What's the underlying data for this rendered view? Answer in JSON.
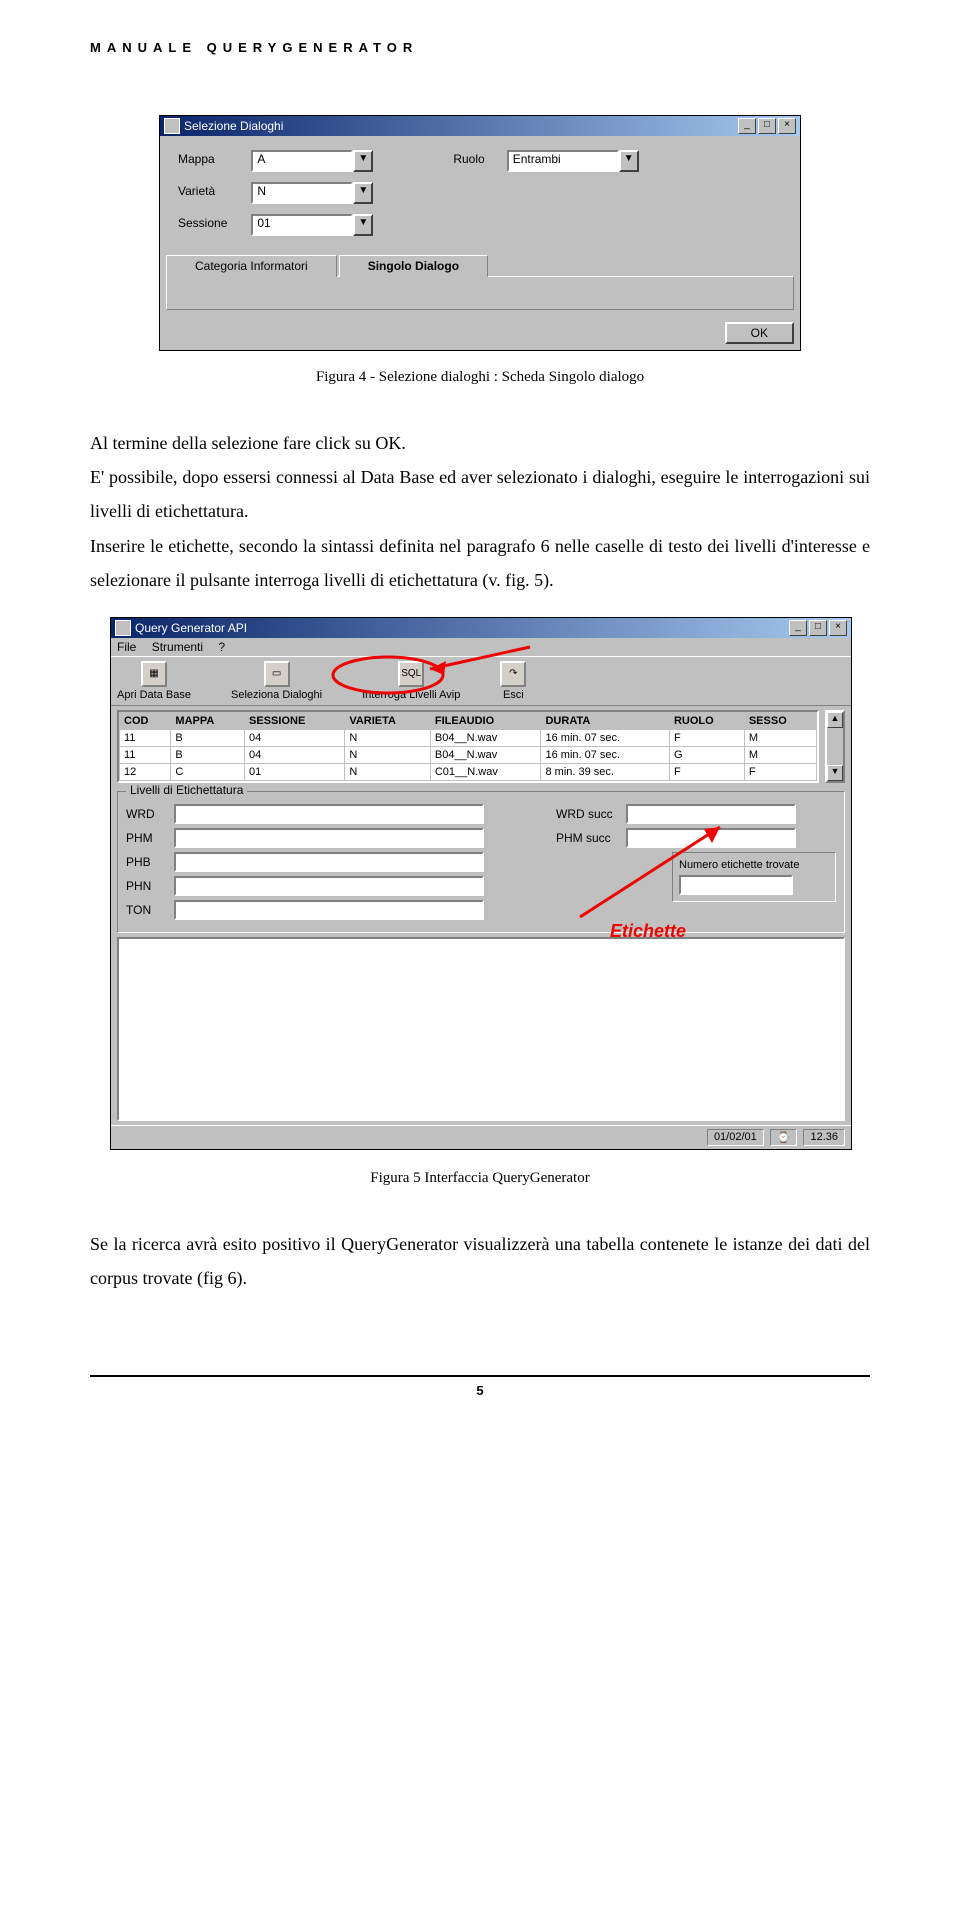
{
  "header": "MANUALE QUERYGENERATOR",
  "fig4": {
    "title": "Selezione Dialoghi",
    "mappa_label": "Mappa",
    "mappa_value": "A",
    "varieta_label": "Varietà",
    "varieta_value": "N",
    "sessione_label": "Sessione",
    "sessione_value": "01",
    "ruolo_label": "Ruolo",
    "ruolo_value": "Entrambi",
    "tab_categoria": "Categoria Informatori",
    "tab_singolo": "Singolo Dialogo",
    "ok": "OK",
    "caption": "Figura 4 - Selezione dialoghi : Scheda Singolo dialogo"
  },
  "body1": "Al termine della selezione fare click su  OK.",
  "body2": "E' possibile, dopo essersi connessi al Data Base ed aver selezionato i dialoghi, eseguire le interrogazioni sui livelli di etichettatura.",
  "body3": "Inserire le etichette, secondo la sintassi definita nel paragrafo 6 nelle caselle di testo dei livelli d'interesse e selezionare il pulsante interroga livelli di etichettatura (v. fig. 5).",
  "fig5": {
    "title": "Query Generator API",
    "menu": {
      "file": "File",
      "strumenti": "Strumenti",
      "q": "?"
    },
    "tool": {
      "apri": "Apri Data Base",
      "seleziona": "Seleziona Dialoghi",
      "interroga": "Interroga Livelli Avip",
      "interroga_icon": "SQL",
      "esci": "Esci"
    },
    "headers": [
      "COD",
      "MAPPA",
      "SESSIONE",
      "VARIETA",
      "FILEAUDIO",
      "DURATA",
      "RUOLO",
      "SESSO"
    ],
    "rows": [
      [
        "11",
        "B",
        "04",
        "N",
        "B04__N.wav",
        "16 min. 07 sec.",
        "F",
        "M"
      ],
      [
        "11",
        "B",
        "04",
        "N",
        "B04__N.wav",
        "16 min. 07 sec.",
        "G",
        "M"
      ],
      [
        "12",
        "C",
        "01",
        "N",
        "C01__N.wav",
        "8 min. 39 sec.",
        "F",
        "F"
      ]
    ],
    "group_legend": "Livelli di Etichettatura",
    "labels": {
      "wrd": "WRD",
      "phm": "PHM",
      "phb": "PHB",
      "phn": "PHN",
      "ton": "TON",
      "wrdsucc": "WRD succ",
      "phmsucc": "PHM succ"
    },
    "numbox_label": "Numero etichette trovate",
    "status_date": "01/02/01",
    "status_time": "12.36",
    "annotation": "Etichette",
    "caption": "Figura 5 Interfaccia QueryGenerator"
  },
  "body4": "Se la ricerca avrà esito positivo il QueryGenerator visualizzerà una tabella contenete le istanze dei dati  del corpus trovate (fig 6).",
  "page_number": "5"
}
